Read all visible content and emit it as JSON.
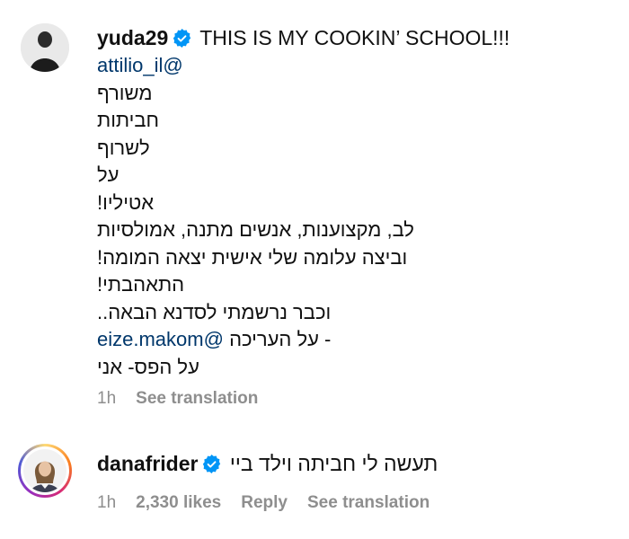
{
  "comments": [
    {
      "username": "yuda29",
      "verified": true,
      "headline_text": "THIS IS MY COOKIN’ SCHOOL!!!",
      "lines": [
        "attilio_il@",
        "משורף",
        "חביתות",
        "לשרוף",
        "על",
        "אטיליו!",
        "לב, מקצוענות, אנשים מתנה, אמולסיות",
        "וביצה עלומה שלי אישית יצאה המומה!",
        "התאהבתי!",
        "וכבר נרשמתי לסדנא הבאה..",
        "eize.makom@",
        "על העריכה -",
        "על הפס- אני"
      ],
      "time": "1h",
      "see_translation": "See translation"
    },
    {
      "username": "danafrider",
      "verified": true,
      "text": "תעשה לי חביתה וילד ביי",
      "time": "1h",
      "likes": "2,330 likes",
      "reply": "Reply",
      "see_translation": "See translation"
    }
  ],
  "colors": {
    "mention": "#00376b",
    "verified": "#0095f6",
    "meta": "#8e8e8e"
  }
}
